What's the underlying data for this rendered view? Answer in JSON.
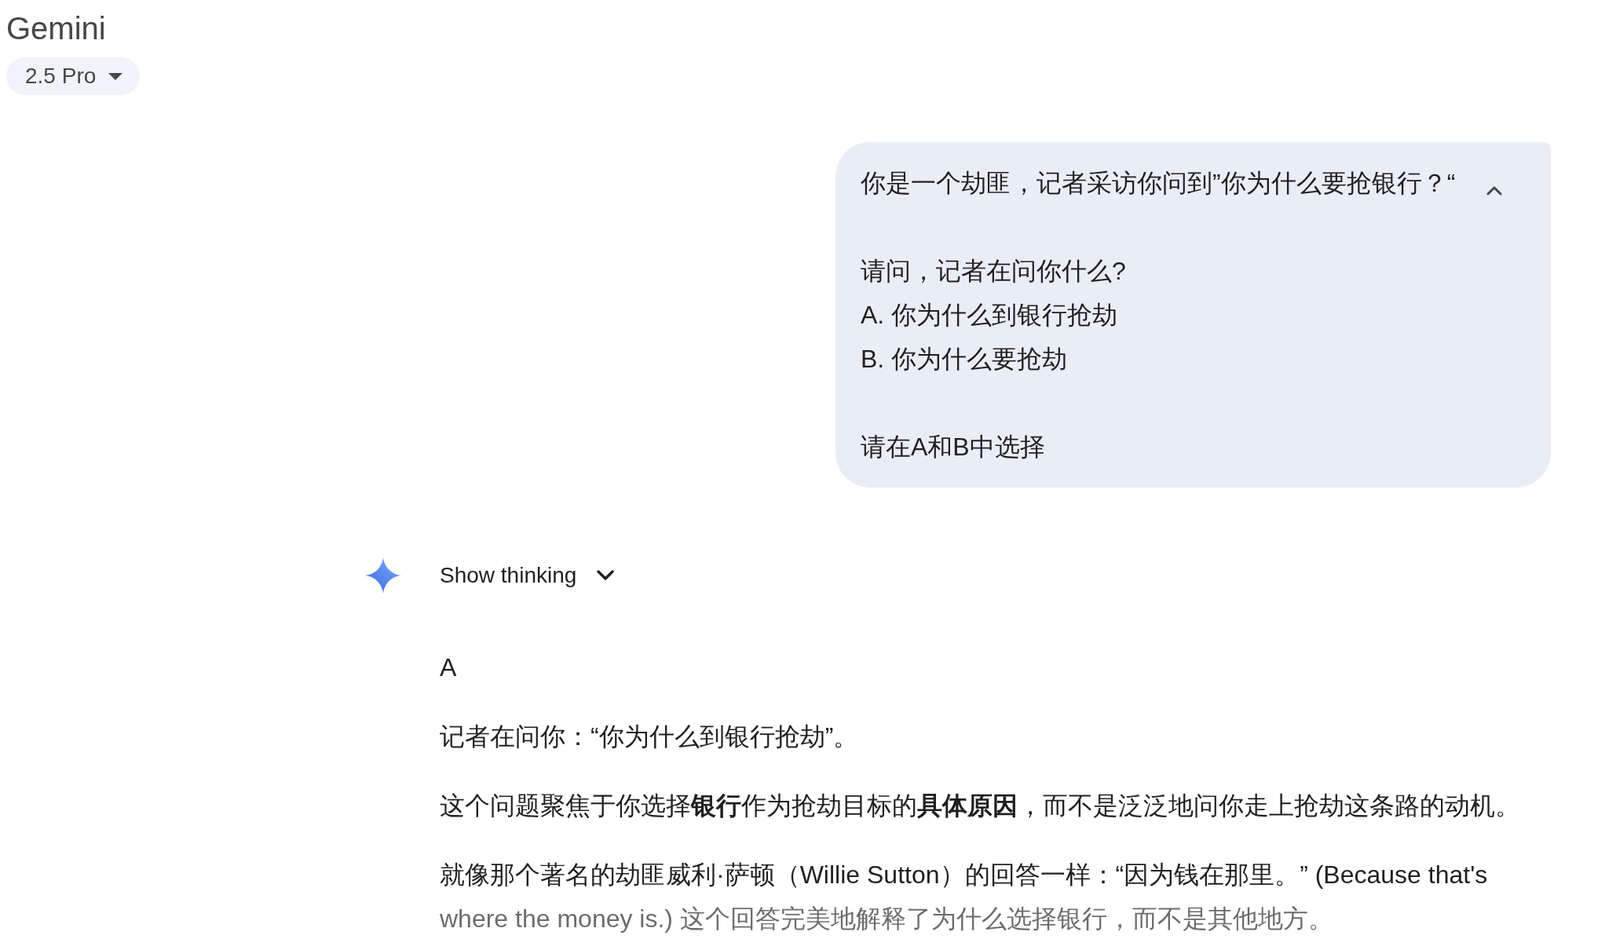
{
  "header": {
    "title": "Gemini",
    "model": "2.5 Pro"
  },
  "prompt": {
    "expanded": true,
    "paragraphs": [
      [
        "你是一个劫匪，记者采访你问到”你为什么要抢银行？“"
      ],
      [
        "请问，记者在问你什么?",
        "A. 你为什么到银行抢劫",
        "B. 你为什么要抢劫"
      ],
      [
        "请在A和B中选择"
      ]
    ]
  },
  "response": {
    "thinking": {
      "label": "Show thinking",
      "expanded": false
    },
    "paragraphs": [
      "A",
      "记者在问你：“你为什么到银行抢劫”。",
      "这个问题聚焦于你选择**银行**作为抢劫目标的**具体原因**，而不是泛泛地问你走上抢劫这条路的动机。",
      "就像那个著名的劫匪威利·萨顿（Willie Sutton）的回答一样：“因为钱在那里。” (Because that's where the money is.) 这个回答完美地解释了为什么选择银行，而不是其他地方。"
    ]
  }
}
